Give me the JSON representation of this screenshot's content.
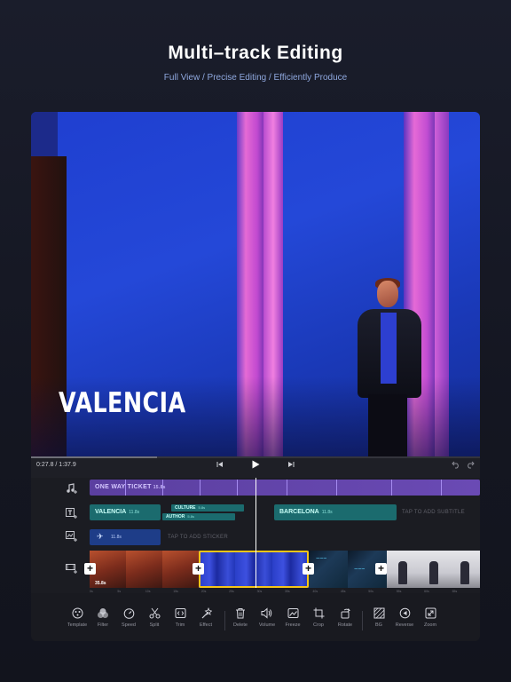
{
  "header": {
    "title": "Multi–track Editing",
    "subtitle": "Full View / Precise Editing / Efficiently Produce"
  },
  "preview": {
    "overlay_text": "VALENCIA"
  },
  "playback": {
    "timecode": "0:27.8 / 1:37.9",
    "progress": 0.28
  },
  "tracks": {
    "music": {
      "label": "ONE WAY TICKET",
      "duration": "15.8s"
    },
    "text": {
      "clip1": {
        "label": "VALENCIA",
        "duration": "11.8s"
      },
      "clip2": {
        "label": "CULTURE",
        "duration": "5.8s"
      },
      "clip3": {
        "label": "AUTHOR",
        "duration": "5.8s"
      },
      "clip4": {
        "label": "BARCELONA",
        "duration": "11.8s"
      },
      "placeholder": "TAP TO ADD SUBTITLE"
    },
    "sticker": {
      "duration": "11.8s",
      "placeholder": "TAP TO ADD STICKER"
    },
    "video": {
      "first_clip_duration": "35.8s"
    }
  },
  "ruler": [
    "0s",
    "5s",
    "10s",
    "15s",
    "20s",
    "25s",
    "30s",
    "35s",
    "40s",
    "45s",
    "50s",
    "55s",
    "60s",
    "65s"
  ],
  "toolbar": {
    "template": "Template",
    "filter": "Filter",
    "speed": "Speed",
    "split": "Split",
    "trim": "Trim",
    "effect": "Effect",
    "delete": "Delete",
    "volume": "Volume",
    "freeze": "Freeze",
    "crop": "Crop",
    "rotate": "Rotate",
    "bg": "BG",
    "reverse": "Reverse",
    "zoom": "Zoom"
  },
  "colors": {
    "accent_selection": "#f5c518",
    "music_track": "#5b3fa0",
    "text_clip": "#1b6b6e",
    "sticker_clip": "#1e3d88"
  }
}
